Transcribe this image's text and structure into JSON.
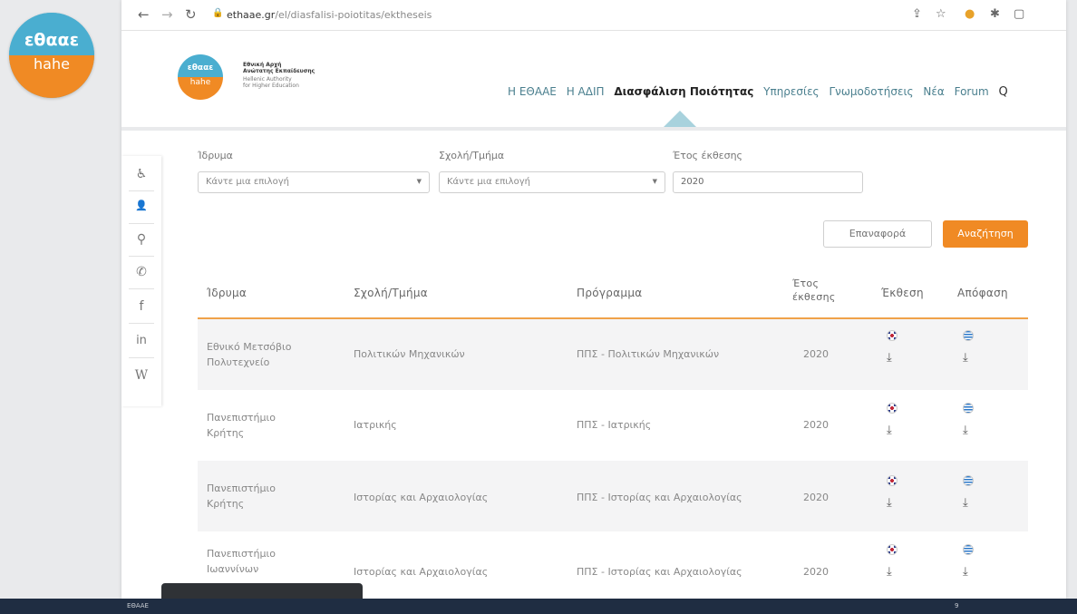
{
  "slide": {
    "logo_top": "εθααε",
    "logo_bottom": "hahe",
    "footer_left": "ΕΘΑΑΕ",
    "footer_right": "9"
  },
  "browser": {
    "url_host": "ethaae.gr",
    "url_path": "/el/diasfalisi-poiotitas/ektheseis"
  },
  "site": {
    "logo_top": "εθααε",
    "logo_bottom": "hahe",
    "name_gr_1": "Εθνική Αρχή",
    "name_gr_2": "Ανώτατης Εκπαίδευσης",
    "name_en_1": "Hellenic Authority",
    "name_en_2": "for Higher Education",
    "nav": [
      "Η ΕΘΑΑΕ",
      "Η ΑΔΙΠ",
      "Διασφάλιση Ποιότητας",
      "Υπηρεσίες",
      "Γνωμοδοτήσεις",
      "Νέα",
      "Forum"
    ]
  },
  "filters": {
    "institution_label": "Ίδρυμα",
    "institution_value": "Κάντε μια επιλογή",
    "school_label": "Σχολή/Τμήμα",
    "school_value": "Κάντε μια επιλογή",
    "year_label": "Έτος έκθεσης",
    "year_value": "2020",
    "reset_label": "Επαναφορά",
    "search_label": "Αναζήτηση"
  },
  "table": {
    "headers": {
      "institution": "Ίδρυμα",
      "school": "Σχολή/Τμήμα",
      "program": "Πρόγραμμα",
      "year_1": "Έτος",
      "year_2": "έκθεσης",
      "report": "Έκθεση",
      "decision": "Απόφαση"
    },
    "rows": [
      {
        "institution_1": "Εθνικό Μετσόβιο",
        "institution_2": "Πολυτεχνείο",
        "school": "Πολιτικών Μηχανικών",
        "program": "ΠΠΣ - Πολιτικών Μηχανικών",
        "year": "2020"
      },
      {
        "institution_1": "Πανεπιστήμιο",
        "institution_2": "Κρήτης",
        "school": "Ιατρικής",
        "program": "ΠΠΣ - Ιατρικής",
        "year": "2020"
      },
      {
        "institution_1": "Πανεπιστήμιο",
        "institution_2": "Κρήτης",
        "school": "Ιστορίας και Αρχαιολογίας",
        "program": "ΠΠΣ - Ιστορίας και Αρχαιολογίας",
        "year": "2020"
      },
      {
        "institution_1": "Πανεπιστήμιο",
        "institution_2": "Ιωαννίνων",
        "school": "Ιστορίας και Αρχαιολογίας",
        "program": "ΠΠΣ - Ιστορίας και Αρχαιολογίας",
        "year": "2020"
      }
    ]
  },
  "side_icons": {
    "accessibility": "♿",
    "user": "👤",
    "search": "⚲",
    "phone": "✆",
    "facebook": "f",
    "linkedin": "in",
    "wikipedia": "W"
  },
  "colors": {
    "accent_orange": "#f08a24",
    "brand_blue": "#4aaed0",
    "footer_navy": "#1f2d42"
  }
}
